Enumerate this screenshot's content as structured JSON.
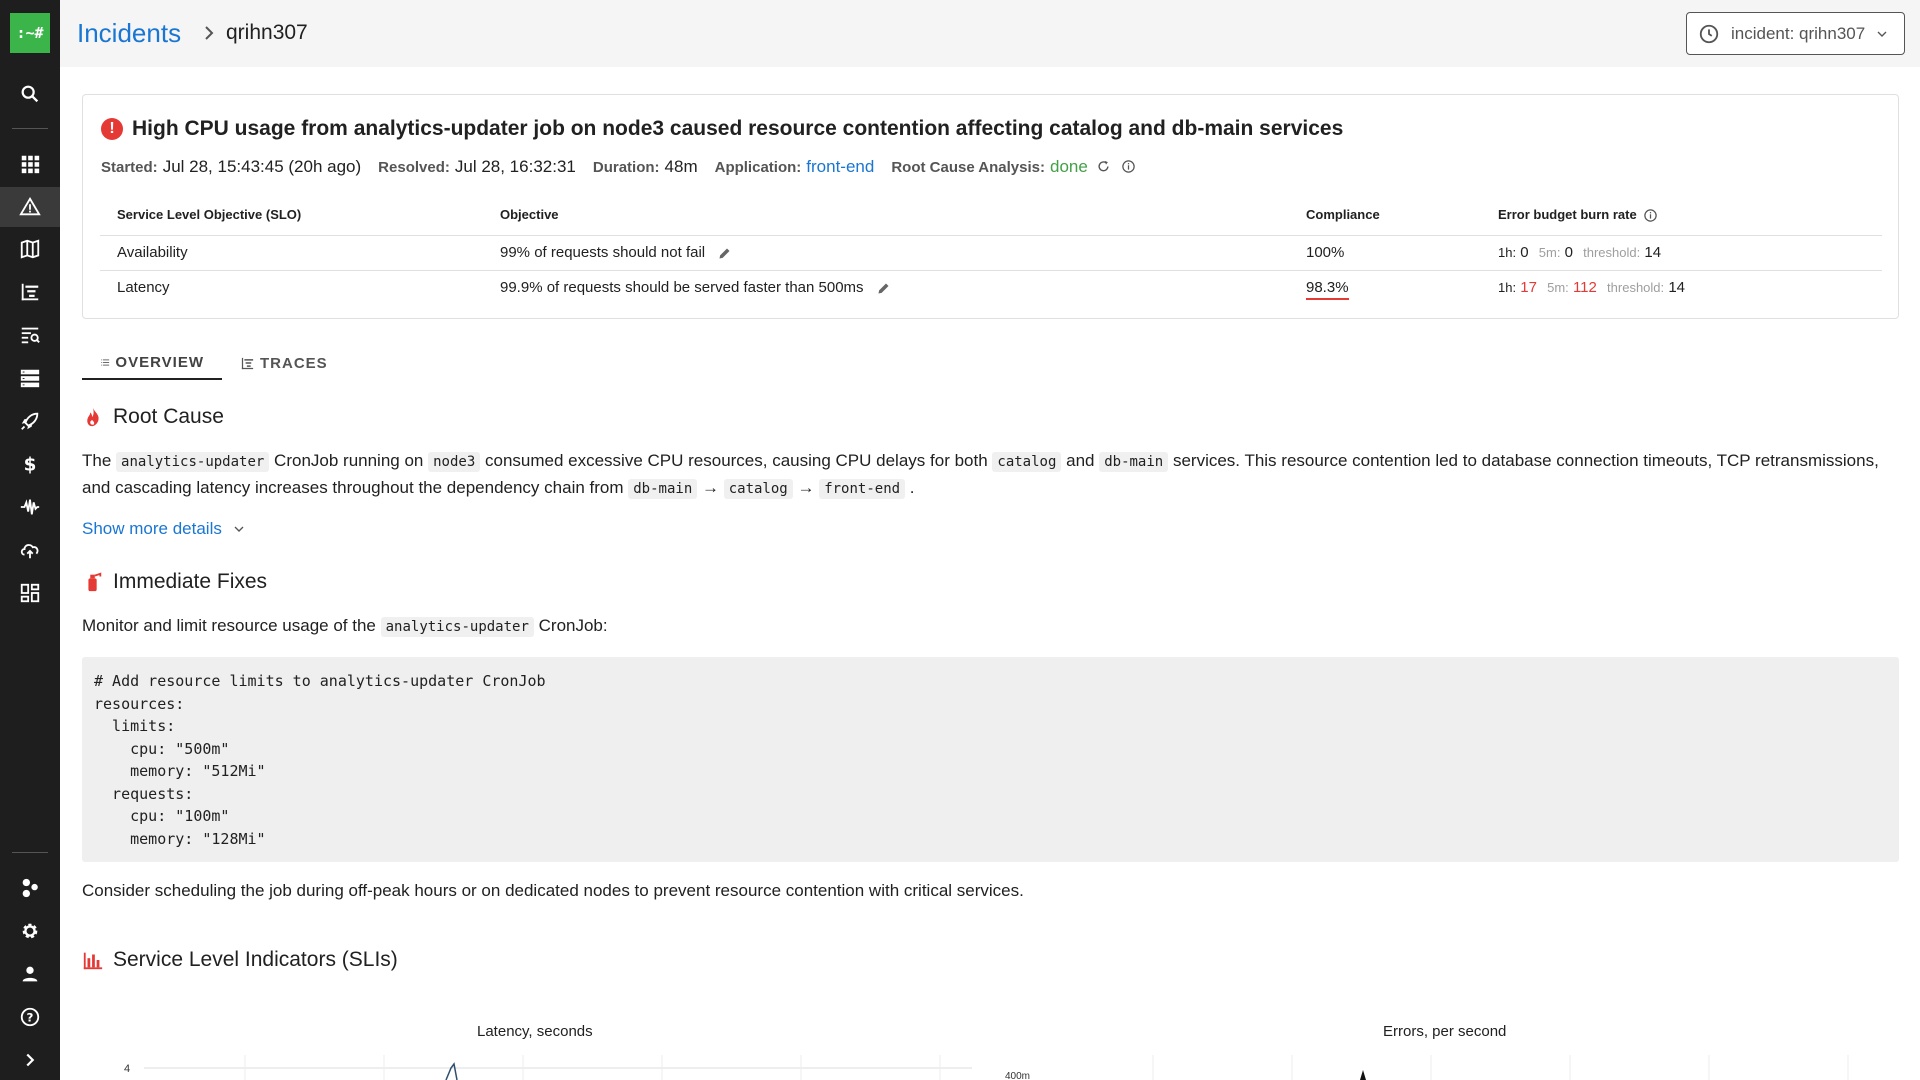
{
  "app": {
    "logo_text": ":~#"
  },
  "sidebar": {
    "items": [
      {
        "icon": "search-icon"
      },
      {
        "icon": "apps-grid-icon"
      },
      {
        "icon": "warning-icon",
        "active": true
      },
      {
        "icon": "map-icon"
      },
      {
        "icon": "tracing-icon"
      },
      {
        "icon": "log-search-icon"
      },
      {
        "icon": "server-icon"
      },
      {
        "icon": "rocket-icon"
      },
      {
        "icon": "dollar-icon"
      },
      {
        "icon": "waveform-icon"
      },
      {
        "icon": "cloud-sync-icon"
      },
      {
        "icon": "dashboard-icon"
      },
      {
        "icon": "integrations-icon"
      },
      {
        "icon": "gear-icon"
      },
      {
        "icon": "user-icon"
      },
      {
        "icon": "help-icon"
      },
      {
        "icon": "expand-icon"
      }
    ]
  },
  "header": {
    "breadcrumb_root": "Incidents",
    "breadcrumb_current": "qrihn307",
    "incident_selector": "incident: qrihn307"
  },
  "incident": {
    "title": "High CPU usage from analytics-updater job on node3 caused resource contention affecting catalog and db-main services",
    "started_label": "Started:",
    "started_value": "Jul 28, 15:43:45 (20h ago)",
    "resolved_label": "Resolved:",
    "resolved_value": "Jul 28, 16:32:31",
    "duration_label": "Duration:",
    "duration_value": "48m",
    "application_label": "Application:",
    "application_value": "front-end",
    "rca_label": "Root Cause Analysis:",
    "rca_value": "done",
    "colors": {
      "error": "#e53935",
      "success": "#43a047",
      "link": "#1976d2"
    }
  },
  "slo_table": {
    "headers": [
      "Service Level Objective (SLO)",
      "Objective",
      "Compliance",
      "Error budget burn rate"
    ],
    "rows": [
      {
        "name": "Availability",
        "objective": "99% of requests should not fail",
        "compliance": "100%",
        "burn_1h_label": "1h:",
        "burn_1h": "0",
        "burn_5m_label": "5m:",
        "burn_5m": "0",
        "threshold_label": "threshold:",
        "threshold": "14"
      },
      {
        "name": "Latency",
        "objective": "99.9% of requests should be served faster than 500ms",
        "compliance": "98.3%",
        "burn_1h_label": "1h:",
        "burn_1h": "17",
        "burn_5m_label": "5m:",
        "burn_5m": "112",
        "threshold_label": "threshold:",
        "threshold": "14"
      }
    ]
  },
  "tabs": [
    {
      "label": "OVERVIEW",
      "active": true
    },
    {
      "label": "TRACES",
      "active": false
    }
  ],
  "root_cause": {
    "heading": "Root Cause",
    "p1": "The ",
    "c1": "analytics-updater",
    "p2": " CronJob running on ",
    "c2": "node3",
    "p3": " consumed excessive CPU resources, causing CPU delays for both ",
    "c3": "catalog",
    "p4": " and ",
    "c4": "db-main",
    "p5": " services. This resource contention led to database connection timeouts, TCP retransmissions, and cascading latency increases throughout the dependency chain from ",
    "c5": "db-main",
    "arrow1": " → ",
    "c6": "catalog",
    "arrow2": " → ",
    "c7": "front-end",
    "p6": " .",
    "show_more": "Show more details"
  },
  "immediate_fixes": {
    "heading": "Immediate Fixes",
    "intro_1": "Monitor and limit resource usage of the ",
    "intro_code": "analytics-updater",
    "intro_2": " CronJob:",
    "code": "# Add resource limits to analytics-updater CronJob\nresources:\n  limits:\n    cpu: \"500m\"\n    memory: \"512Mi\"\n  requests:\n    cpu: \"100m\"\n    memory: \"128Mi\"",
    "outro": "Consider scheduling the job during off-peak hours or on dedicated nodes to prevent resource contention with critical services."
  },
  "sli": {
    "heading": "Service Level Indicators (SLIs)"
  },
  "chart_data": [
    {
      "type": "line",
      "title": "Latency, seconds",
      "y_tick_visible": "4"
    },
    {
      "type": "line",
      "title": "Errors, per second",
      "y_tick_visible": "400m"
    }
  ]
}
